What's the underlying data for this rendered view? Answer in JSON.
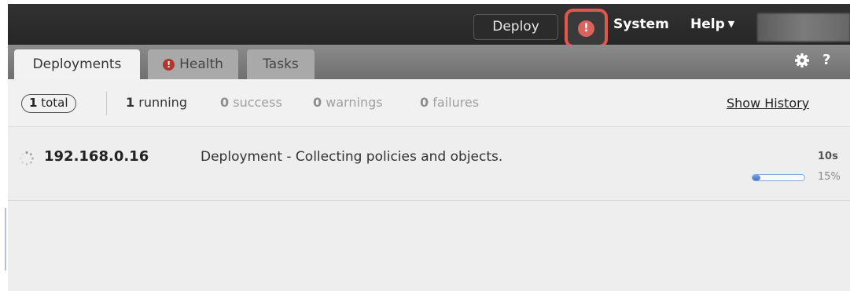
{
  "topbar": {
    "deploy_label": "Deploy",
    "alert_glyph": "!",
    "system_label": "System",
    "help_label": "Help",
    "help_caret": "▼",
    "user_caret": "▼"
  },
  "tabs": [
    {
      "label": "Deployments",
      "active": true
    },
    {
      "label": "Health",
      "icon": "alert-icon",
      "icon_glyph": "!"
    },
    {
      "label": "Tasks"
    }
  ],
  "tab_icons": {
    "gear": "gear-icon",
    "help_glyph": "?"
  },
  "summary": {
    "total_count": "1",
    "total_label": "total",
    "running_count": "1",
    "running_label": "running",
    "success_count": "0",
    "success_label": "success",
    "warnings_count": "0",
    "warnings_label": "warnings",
    "failures_count": "0",
    "failures_label": "failures",
    "show_history": "Show History"
  },
  "deployments": [
    {
      "device": "192.168.0.16",
      "message": "Deployment - Collecting policies and objects.",
      "elapsed": "10s",
      "progress_label": "15%",
      "progress": 15
    }
  ],
  "colors": {
    "alert_outline": "#e2574c",
    "alert_red": "#b5342c",
    "progress_blue": "#3f74c6"
  }
}
